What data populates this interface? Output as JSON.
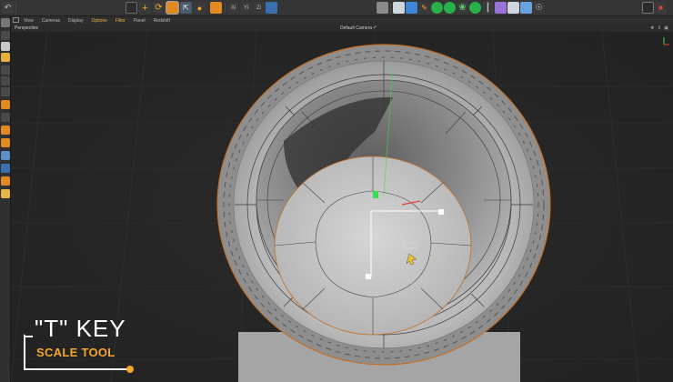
{
  "menubar": {
    "items": [
      "View",
      "Cameras",
      "Display",
      "Options",
      "Filter",
      "Panel",
      "Redshift"
    ],
    "active_index": 3
  },
  "viewport": {
    "label": "Perspective",
    "camera": "Default Camera •°"
  },
  "caption": {
    "title": "\"T\" KEY",
    "subtitle": "SCALE TOOL"
  },
  "colors": {
    "accent_orange": "#f2a82c",
    "ui_bg": "#353535",
    "viewport_bg": "#252525",
    "axis_green": "#3ddc4f",
    "axis_red": "#e0413c"
  },
  "toolbar_icons": [
    "undo-icon",
    "select-icon",
    "move-icon",
    "rotate-icon",
    "scale-icon",
    "last-tool-icon",
    "coord-x-icon",
    "coord-y-icon",
    "coord-z-icon",
    "world-coord-icon",
    "render-view-icon",
    "render-icon",
    "render-settings-icon",
    "cube-icon",
    "pen-icon",
    "subdivision-icon",
    "array-icon",
    "deformer-icon",
    "field-icon",
    "scene-icon",
    "camera-icon",
    "light-icon"
  ]
}
